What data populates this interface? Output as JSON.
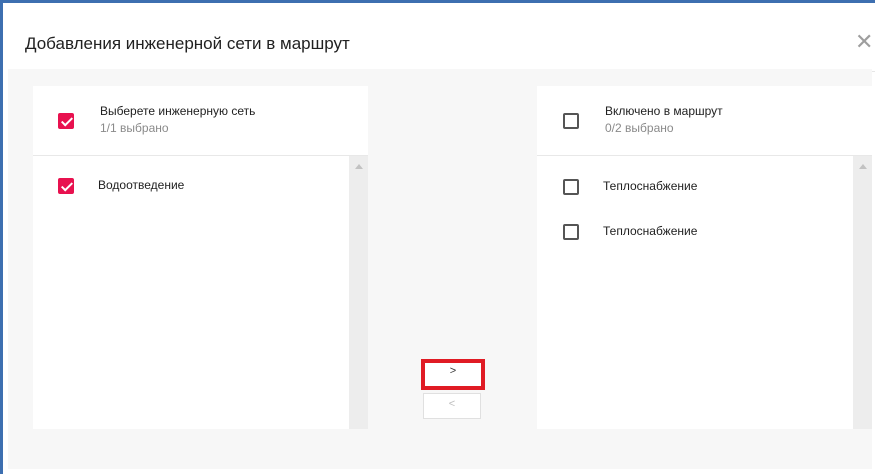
{
  "dialog": {
    "title": "Добавления инженерной сети в маршрут",
    "close_icon": "close-icon"
  },
  "left_panel": {
    "header_title": "Выберете инженерную сеть",
    "header_count": "1/1 выбрано",
    "header_checked": true,
    "items": [
      {
        "label": "Водоотведение",
        "checked": true
      }
    ]
  },
  "right_panel": {
    "header_title": "Включено в маршрут",
    "header_count": "0/2 выбрано",
    "header_checked": false,
    "items": [
      {
        "label": "Теплоснабжение",
        "checked": false
      },
      {
        "label": "Теплоснабжение",
        "checked": false
      }
    ]
  },
  "transfer": {
    "move_right_label": ">",
    "move_left_label": "<"
  },
  "colors": {
    "accent": "#e8114f",
    "highlight": "#e01b24",
    "frame": "#3d6fb0"
  }
}
